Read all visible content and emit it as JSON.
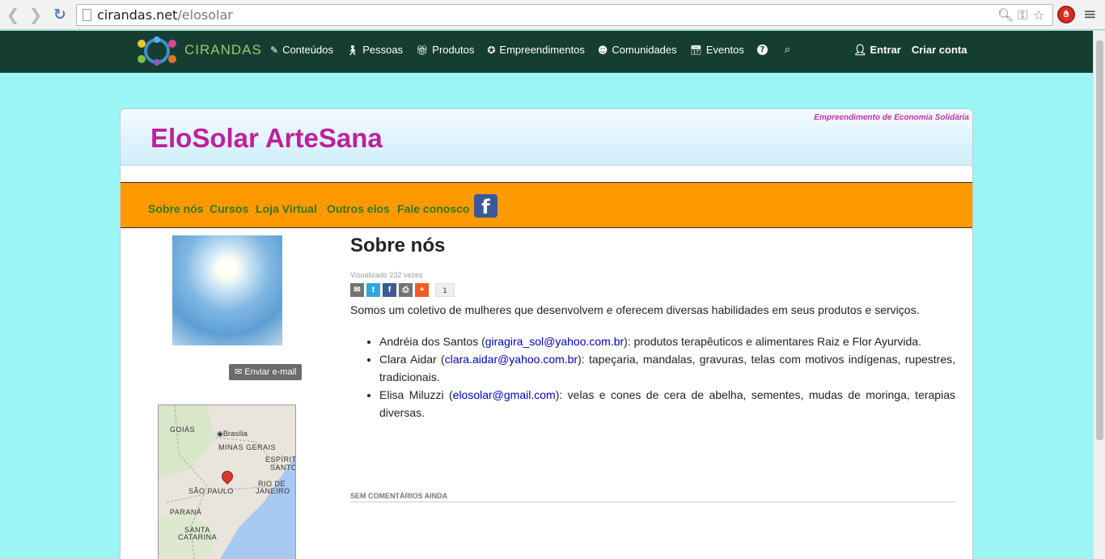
{
  "browser": {
    "url_host": "cirandas.net",
    "url_path": "/elosolar"
  },
  "site": {
    "logo_text": "CIRANDAS",
    "menu": [
      {
        "label": "Conteúdos",
        "icon": "edit-icon"
      },
      {
        "label": "Pessoas",
        "icon": "person-icon"
      },
      {
        "label": "Produtos",
        "icon": "gift-icon"
      },
      {
        "label": "Empreendimentos",
        "icon": "star-circle-icon"
      },
      {
        "label": "Comunidades",
        "icon": "users-icon"
      },
      {
        "label": "Eventos",
        "icon": "calendar-icon"
      }
    ],
    "login": "Entrar",
    "signup": "Criar conta"
  },
  "profile": {
    "type_tag": "Empreendimento de Economia Solidária",
    "title": "EloSolar ArteSana",
    "nav": [
      "Sobre nós",
      "Cursos",
      "Loja Virtual",
      "Outros elos",
      "Fale conosco"
    ],
    "send_email": "Enviar e-mail"
  },
  "map": {
    "labels": [
      "GOIÁS",
      "Brasília",
      "MINAS GERAIS",
      "ESPÍRITO",
      "SANTO",
      "RIO DE",
      "JANEIRO",
      "SÃO PAULO",
      "PARANÁ",
      "SANTA",
      "CATARINA"
    ]
  },
  "article": {
    "title": "Sobre nós",
    "views": "Visualizado 232 vezes",
    "share_count": "1",
    "intro": "Somos um coletivo de mulheres que desenvolvem e oferecem diversas habilidades em seus produtos e serviços.",
    "members": [
      {
        "name": "Andréia dos Santos (",
        "email": "giragira_sol@yahoo.com.br",
        "desc": "): produtos terapêuticos e alimentares Raiz e Flor Ayurvida."
      },
      {
        "name": "Clara Aidar (",
        "email": "clara.aidar@yahoo.com.br",
        "desc": "): tapeçaria, mandalas, gravuras, telas com motivos indígenas, rupestres, tradicionais."
      },
      {
        "name": "Elisa Miluzzi (",
        "email": "elosolar@gmail.com",
        "desc": "): velas e cones de cera de abelha, sementes, mudas de moringa, terapias diversas."
      }
    ],
    "comments_label": "SEM COMENTÁRIOS AINDA"
  },
  "colors": {
    "site_bar": "#163d32",
    "title": "#bf1f9c",
    "orange_nav": "#ff9900",
    "nav_link": "#2c7a1f",
    "page_bg": "#9cf5f5"
  }
}
